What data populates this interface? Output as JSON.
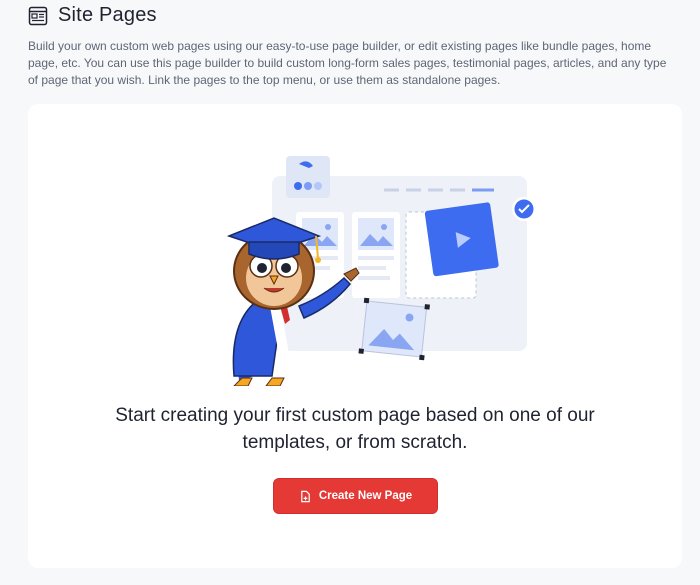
{
  "header": {
    "title": "Site Pages",
    "icon": "browser-window-icon",
    "description": "Build your own custom web pages using our easy-to-use page builder, or edit existing pages like bundle pages, home page, etc. You can use this page builder to build custom long-form sales pages, testimonial pages, articles, and any type of page that you wish. Link the pages to the top menu, or use them as standalone pages."
  },
  "empty_state": {
    "headline": "Start creating your first custom page based on one of our templates, or from scratch.",
    "button_label": "Create New Page",
    "button_icon": "new-page-icon"
  },
  "colors": {
    "accent": "#e53935",
    "illustration_blue": "#3e6cf0"
  }
}
